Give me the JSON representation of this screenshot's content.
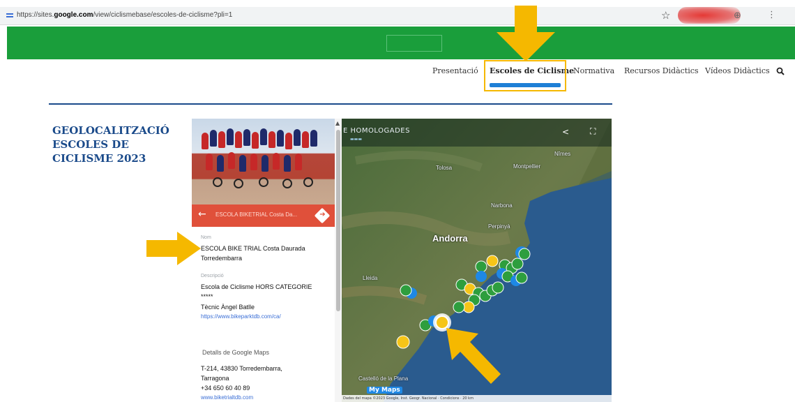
{
  "browser": {
    "url_prefix": "https://sites.",
    "url_domain": "google.com",
    "url_suffix": "/view/ciclismebase/escoles-de-ciclisme?pli=1",
    "star_icon": "star-icon"
  },
  "banner": {
    "message": "",
    "button_label": ""
  },
  "nav": {
    "items": [
      {
        "label": "Presentació"
      },
      {
        "label": "Escoles de Ciclisme"
      },
      {
        "label": "Normativa"
      },
      {
        "label": "Recursos Didàctics"
      },
      {
        "label": "Vídeos Didàctics"
      }
    ],
    "active_index": 1,
    "search_icon": "search-icon"
  },
  "page": {
    "title_lines": [
      "GEOLOCALITZACIÓ",
      "ESCOLES DE",
      "CICLISME 2023"
    ]
  },
  "place": {
    "header_title": "ESCOLA BIKETRIAL Costa Da...",
    "name_label": "Nom",
    "name_lines": [
      "ESCOLA BIKE TRIAL Costa Daurada",
      "Torredembarra"
    ],
    "description_label": "Descripció",
    "description_lines": [
      "Escola de Ciclisme HORS CATEGORIE",
      "*****",
      "Tècnic Àngel Batlle"
    ],
    "website": "https://www.bikeparktdb.com/ca/",
    "details_heading": "Detalls de Google Maps",
    "address_lines": [
      "T-214, 43830 Torredembarra,",
      "Tarragona",
      "+34 650 60 40 89"
    ],
    "footer_link": "www.biketrialtdb.com"
  },
  "map": {
    "title": "E HOMOLOGADES",
    "labels": {
      "tolosa": "Tolosa",
      "montpellier": "Montpellier",
      "andorra": "Andorra",
      "narbona": "Narbona",
      "perpinya": "Perpinyà",
      "nimes": "Nîmes",
      "lleida": "Lleida",
      "castello": "Castelló de la Plana"
    },
    "logo": "My Maps",
    "footer": "Dades del mapa ©2023 Google, Inst. Geogr. Nacional · Condicions · 20 km"
  },
  "colors": {
    "banner_green": "#1a9e3b",
    "accent_blue": "#1a4a8a",
    "header_red": "#e0503a",
    "highlight_yellow": "#f5b800"
  }
}
